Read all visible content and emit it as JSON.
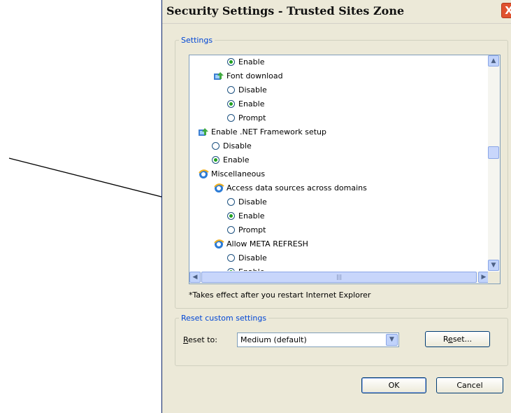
{
  "dialog": {
    "title": "Security Settings - Trusted Sites Zone",
    "close_label": "X"
  },
  "settings_group": {
    "legend": "Settings",
    "rows": [
      {
        "type": "radio",
        "label": "Enable",
        "checked": true,
        "indent": 1
      },
      {
        "type": "category",
        "label": "Font download",
        "icon": "settings-gear-icon",
        "indent": 1
      },
      {
        "type": "radio",
        "label": "Disable",
        "checked": false,
        "indent": 1
      },
      {
        "type": "radio",
        "label": "Enable",
        "checked": true,
        "indent": 1
      },
      {
        "type": "radio",
        "label": "Prompt",
        "checked": false,
        "indent": 1
      },
      {
        "type": "category",
        "label": "Enable .NET Framework setup",
        "icon": "settings-gear-icon",
        "indent": 0
      },
      {
        "type": "radio",
        "label": "Disable",
        "checked": false,
        "indent": 0
      },
      {
        "type": "radio",
        "label": "Enable",
        "checked": true,
        "indent": 0
      },
      {
        "type": "category",
        "label": "Miscellaneous",
        "icon": "internet-explorer-icon",
        "indent": 0
      },
      {
        "type": "category",
        "label": "Access data sources across domains",
        "icon": "internet-explorer-icon",
        "indent": 1
      },
      {
        "type": "radio",
        "label": "Disable",
        "checked": false,
        "indent": 1
      },
      {
        "type": "radio",
        "label": "Enable",
        "checked": true,
        "indent": 1
      },
      {
        "type": "radio",
        "label": "Prompt",
        "checked": false,
        "indent": 1
      },
      {
        "type": "category",
        "label": "Allow META REFRESH",
        "icon": "internet-explorer-icon",
        "indent": 1
      },
      {
        "type": "radio",
        "label": "Disable",
        "checked": false,
        "indent": 1
      },
      {
        "type": "radio",
        "label": "Enable",
        "checked": true,
        "indent": 1
      }
    ]
  },
  "note": "*Takes effect after you restart Internet Explorer",
  "reset_group": {
    "legend": "Reset custom settings",
    "reset_to_label_underline": "R",
    "reset_to_label_rest": "eset to:",
    "combo_value": "Medium (default)",
    "reset_button_pre": "R",
    "reset_button_ul": "e",
    "reset_button_post": "set..."
  },
  "buttons": {
    "ok": "OK",
    "cancel": "Cancel"
  },
  "colors": {
    "dialog_bg": "#ece9d8",
    "group_legend": "#0046d5",
    "radio_checked": "#21a121",
    "close_button": "#e0522f"
  }
}
